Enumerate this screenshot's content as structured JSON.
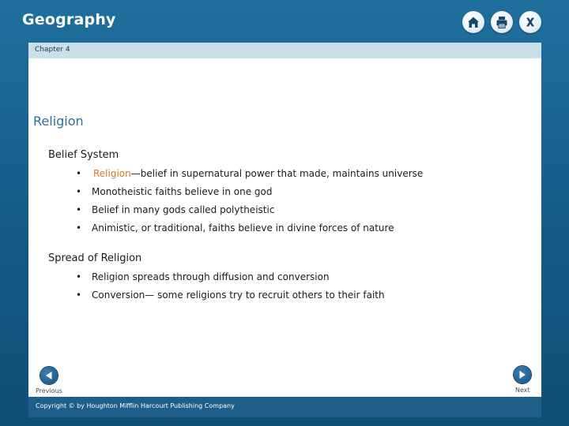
{
  "app": {
    "title": "Geography"
  },
  "toolbar": {
    "icons": [
      "home-icon",
      "print-icon",
      "close-icon"
    ]
  },
  "chapter": {
    "label": "Chapter 4"
  },
  "slide": {
    "title": "Religion",
    "sections": [
      {
        "heading": "Belief System",
        "bullets": [
          {
            "term": "Religion",
            "text": "—belief in supernatural power that made, maintains universe"
          },
          {
            "term": "",
            "text": "Monotheistic faiths believe in one god"
          },
          {
            "term": "",
            "text": "Belief in many gods called polytheistic"
          },
          {
            "term": "",
            "text": "Animistic, or traditional, faiths believe in divine forces of nature"
          }
        ]
      },
      {
        "heading": "Spread of Religion",
        "bullets": [
          {
            "term": "",
            "text": "Religion spreads through diffusion and conversion"
          },
          {
            "term": "",
            "text": "Conversion— some religions try to recruit others to their faith"
          }
        ]
      }
    ],
    "bullet_glyph": "•"
  },
  "nav": {
    "previous_label": "Previous",
    "next_label": "Next"
  },
  "footer": {
    "copyright": "Copyright © by Houghton Mifflin Harcourt Publishing Company"
  },
  "colors": {
    "frame": "#1f6f9e",
    "title": "#2d6f96",
    "term": "#d07f1f",
    "chapter_bar": "#c9dfe9",
    "footer_bar": "#1d5f8a"
  }
}
